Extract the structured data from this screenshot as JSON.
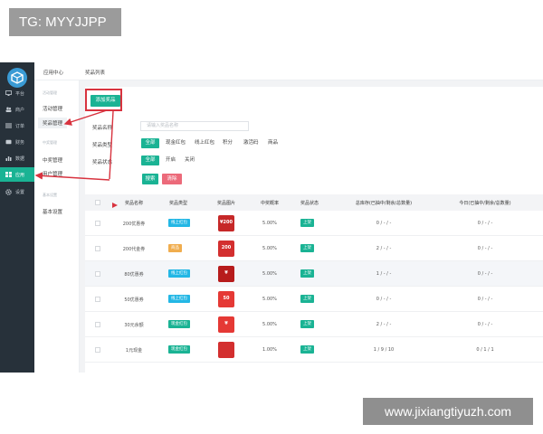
{
  "badge": "TG: MYYJJPP",
  "watermark": "www.jixiangtiyuzh.com",
  "colors": {
    "sidebar": "#27313a",
    "accent": "#1ab394",
    "danger": "#ec6a7a",
    "annotation": "#d8333f",
    "type_cyan": "#23b7e5",
    "type_orange": "#f0ad4e"
  },
  "dark_sidebar": {
    "logo_icon": "cube-icon",
    "items": [
      {
        "label": "平台",
        "icon": "monitor-icon"
      },
      {
        "label": "商户",
        "icon": "users-icon"
      },
      {
        "label": "订单",
        "icon": "list-icon"
      },
      {
        "label": "财务",
        "icon": "wallet-icon"
      },
      {
        "label": "数据",
        "icon": "chart-icon"
      },
      {
        "label": "应用",
        "icon": "apps-icon",
        "active": true
      },
      {
        "label": "设置",
        "icon": "gear-icon"
      }
    ]
  },
  "sub_sidebar": {
    "group1_title": "活动管理",
    "group1_items": [
      "活动管理",
      "奖品管理"
    ],
    "group2_title": "中奖管理",
    "group2_items": [
      "中奖管理",
      "用户管理"
    ],
    "group3_title": "基本设置",
    "group3_items": [
      "基本设置"
    ]
  },
  "topbar": {
    "item1": "应用中心",
    "item2": "奖品列表"
  },
  "toolbar": {
    "add_button": "添加奖品"
  },
  "filters": {
    "name_label": "奖品名称",
    "name_placeholder": "请输入奖品名称",
    "type_label": "奖品类型",
    "type_options": [
      "全部",
      "现金红包",
      "线上红包",
      "积分",
      "激活码",
      "商品"
    ],
    "status_label": "奖品状态",
    "status_options": [
      "全部",
      "开启",
      "关闭"
    ],
    "search_button": "搜索",
    "clear_button": "清除"
  },
  "table": {
    "headers": [
      "奖品名称",
      "奖品类型",
      "奖品图片",
      "中奖概率",
      "奖品状态",
      "总库存(已抽中/剩余/总数量)",
      "今日(已抽中/剩余/总数量)"
    ],
    "rows": [
      {
        "name": "200优惠券",
        "type": "线上红包",
        "type_color": "#23b7e5",
        "image_text": "¥200",
        "image_color": "#c62828",
        "rate": "5.00%",
        "status": "上架",
        "total": "0 / - / -",
        "today": "0 / - / -"
      },
      {
        "name": "200代金券",
        "type": "商品",
        "type_color": "#f0ad4e",
        "image_text": "200",
        "image_color": "#d32f2f",
        "rate": "5.00%",
        "status": "上架",
        "total": "2 / - / -",
        "today": "0 / - / -"
      },
      {
        "name": "80优惠券",
        "type": "线上红包",
        "type_color": "#23b7e5",
        "image_text": "¥",
        "image_color": "#b71c1c",
        "rate": "5.00%",
        "status": "上架",
        "total": "1 / - / -",
        "today": "0 / - / -"
      },
      {
        "name": "50优惠券",
        "type": "线上红包",
        "type_color": "#23b7e5",
        "image_text": "50",
        "image_color": "#e53935",
        "rate": "5.00%",
        "status": "上架",
        "total": "0 / - / -",
        "today": "0 / - / -"
      },
      {
        "name": "30元余额",
        "type": "现金红包",
        "type_color": "#1ab394",
        "image_text": "¥",
        "image_color": "#e53935",
        "rate": "5.00%",
        "status": "上架",
        "total": "2 / - / -",
        "today": "0 / - / -"
      },
      {
        "name": "1元现金",
        "type": "现金红包",
        "type_color": "#1ab394",
        "image_text": "",
        "image_color": "#d32f2f",
        "rate": "1.00%",
        "status": "上架",
        "total": "1 / 9 / 10",
        "today": "0 / 1 / 1"
      }
    ]
  }
}
